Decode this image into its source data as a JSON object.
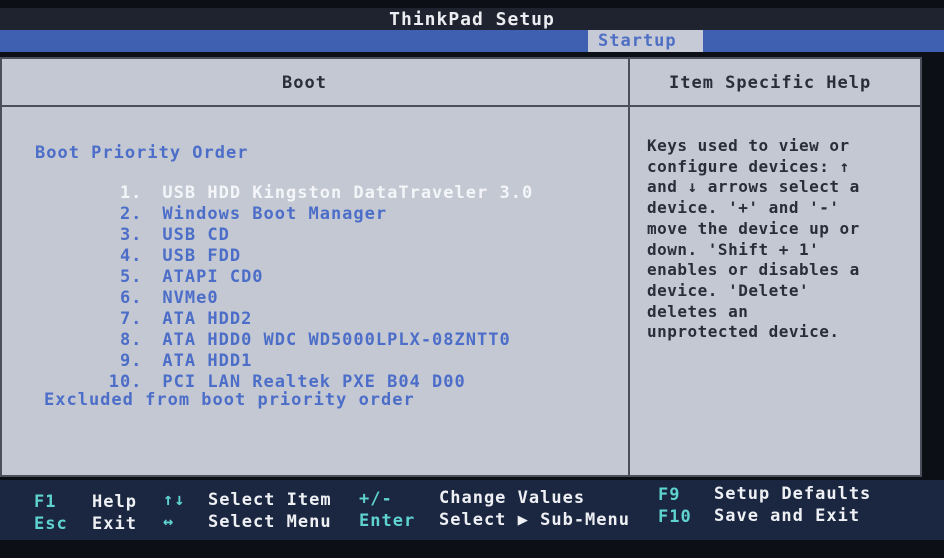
{
  "title": "ThinkPad Setup",
  "tabs": {
    "active": "Startup"
  },
  "panel": {
    "left_header": "Boot",
    "right_header": "Item Specific Help"
  },
  "boot": {
    "section_title": "Boot Priority Order",
    "items": [
      {
        "num": "1.",
        "label": "USB HDD Kingston DataTraveler 3.0"
      },
      {
        "num": "2.",
        "label": "Windows Boot Manager"
      },
      {
        "num": "3.",
        "label": "USB CD"
      },
      {
        "num": "4.",
        "label": "USB FDD"
      },
      {
        "num": "5.",
        "label": "ATAPI CD0"
      },
      {
        "num": "6.",
        "label": "NVMe0"
      },
      {
        "num": "7.",
        "label": "ATA HDD2"
      },
      {
        "num": "8.",
        "label": "ATA HDD0 WDC WD5000LPLX-08ZNTT0"
      },
      {
        "num": "9.",
        "label": "ATA HDD1"
      },
      {
        "num": "10.",
        "label": "PCI LAN Realtek PXE B04 D00"
      }
    ],
    "excluded_label": "Excluded from boot priority order"
  },
  "help": {
    "lines": [
      "Keys used to view or",
      "configure devices: ↑",
      "and ↓ arrows select a",
      "device. '+' and '-'",
      "move the device up or",
      "down. 'Shift + 1'",
      "enables or disables a",
      "device. 'Delete'",
      "deletes an",
      "unprotected device."
    ]
  },
  "footer": {
    "row1": [
      {
        "key": "F1",
        "desc": "Help"
      },
      {
        "key": "↑↓",
        "desc": "Select Item"
      },
      {
        "key": "+/-",
        "desc": "Change Values"
      },
      {
        "key": "F9",
        "desc": "Setup Defaults"
      }
    ],
    "row2": [
      {
        "key": "Esc",
        "desc": "Exit"
      },
      {
        "key": "↔",
        "desc": "Select Menu"
      },
      {
        "key": "Enter",
        "desc": "Select ▶ Sub-Menu"
      },
      {
        "key": "F10",
        "desc": "Save and Exit"
      }
    ]
  },
  "colors": {
    "panel_bg": "#c3c8d3",
    "accent_blue": "#4d6ec8",
    "tabstrip": "#3f5fb0",
    "footer_bg": "#1b2741",
    "key_cyan": "#5fd3cf"
  }
}
